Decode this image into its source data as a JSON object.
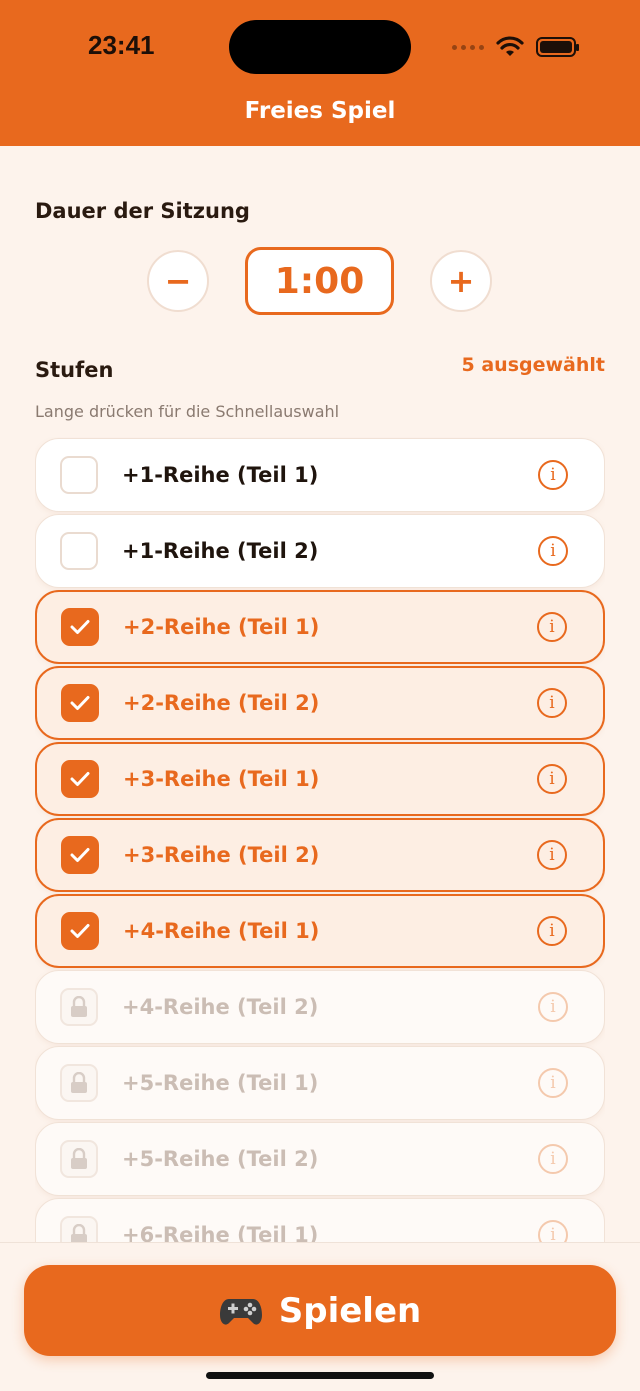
{
  "status_bar": {
    "time": "23:41"
  },
  "header": {
    "title": "Freies Spiel"
  },
  "duration": {
    "label": "Dauer der Sitzung",
    "minus": "−",
    "value": "1:00",
    "plus": "+"
  },
  "levels": {
    "label": "Stufen",
    "selected_count": "5 ausgewählt",
    "hint": "Lange drücken für die Schnellauswahl",
    "items": [
      {
        "label": "+1-Reihe (Teil 1)",
        "state": "unchecked"
      },
      {
        "label": "+1-Reihe (Teil 2)",
        "state": "unchecked"
      },
      {
        "label": "+2-Reihe (Teil 1)",
        "state": "checked"
      },
      {
        "label": "+2-Reihe (Teil 2)",
        "state": "checked"
      },
      {
        "label": "+3-Reihe (Teil 1)",
        "state": "checked"
      },
      {
        "label": "+3-Reihe (Teil 2)",
        "state": "checked"
      },
      {
        "label": "+4-Reihe (Teil 1)",
        "state": "checked"
      },
      {
        "label": "+4-Reihe (Teil 2)",
        "state": "locked"
      },
      {
        "label": "+5-Reihe (Teil 1)",
        "state": "locked"
      },
      {
        "label": "+5-Reihe (Teil 2)",
        "state": "locked"
      },
      {
        "label": "+6-Reihe (Teil 1)",
        "state": "locked"
      }
    ],
    "info_glyph": "i"
  },
  "footer": {
    "play_label": "Spielen",
    "play_icon": "gamepad-icon"
  },
  "colors": {
    "accent": "#e8691e",
    "background": "#fdf3ec"
  }
}
